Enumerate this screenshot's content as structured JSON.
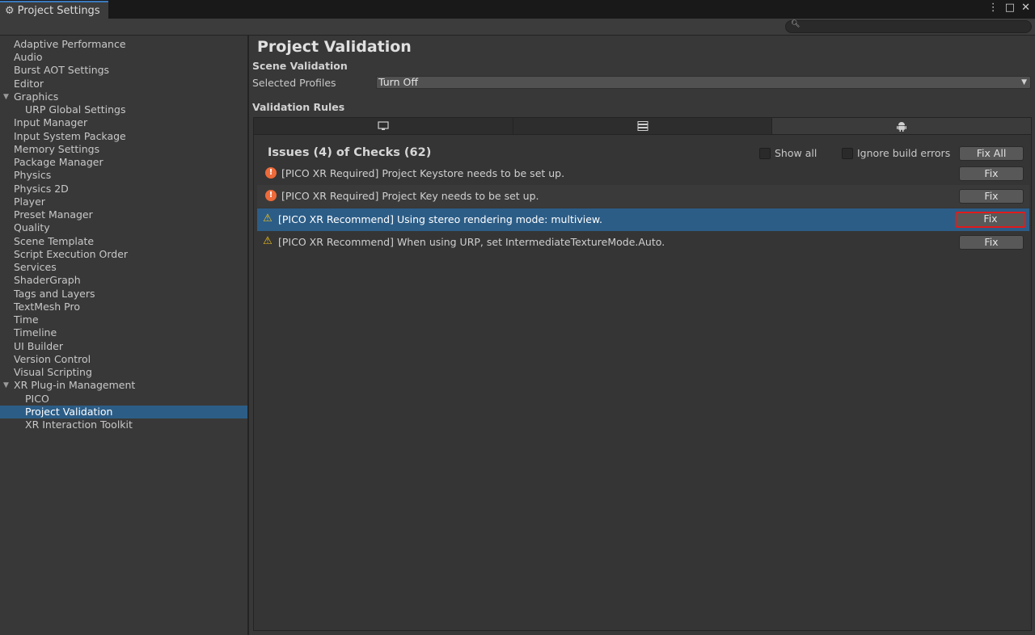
{
  "window": {
    "tab_title": "Project Settings",
    "controls": {
      "menu": "⋮",
      "maximize": "□",
      "close": "✕"
    }
  },
  "search": {
    "placeholder": "",
    "value": ""
  },
  "sidebar": {
    "items": [
      {
        "label": "Adaptive Performance"
      },
      {
        "label": "Audio"
      },
      {
        "label": "Burst AOT Settings"
      },
      {
        "label": "Editor"
      },
      {
        "label": "Graphics"
      },
      {
        "label": "URP Global Settings"
      },
      {
        "label": "Input Manager"
      },
      {
        "label": "Input System Package"
      },
      {
        "label": "Memory Settings"
      },
      {
        "label": "Package Manager"
      },
      {
        "label": "Physics"
      },
      {
        "label": "Physics 2D"
      },
      {
        "label": "Player"
      },
      {
        "label": "Preset Manager"
      },
      {
        "label": "Quality"
      },
      {
        "label": "Scene Template"
      },
      {
        "label": "Script Execution Order"
      },
      {
        "label": "Services"
      },
      {
        "label": "ShaderGraph"
      },
      {
        "label": "Tags and Layers"
      },
      {
        "label": "TextMesh Pro"
      },
      {
        "label": "Time"
      },
      {
        "label": "Timeline"
      },
      {
        "label": "UI Builder"
      },
      {
        "label": "Version Control"
      },
      {
        "label": "Visual Scripting"
      },
      {
        "label": "XR Plug-in Management"
      },
      {
        "label": "PICO"
      },
      {
        "label": "Project Validation"
      },
      {
        "label": "XR Interaction Toolkit"
      }
    ],
    "selected": "Project Validation"
  },
  "main": {
    "title": "Project Validation",
    "scene_validation_label": "Scene Validation",
    "selected_profiles_label": "Selected Profiles",
    "selected_profiles_value": "Turn Off",
    "validation_rules_label": "Validation Rules",
    "platform_tabs": [
      {
        "icon": "monitor-icon"
      },
      {
        "icon": "server-icon"
      },
      {
        "icon": "android-icon"
      }
    ],
    "issues_summary": "Issues (4) of Checks (62)",
    "show_all_label": "Show all",
    "ignore_build_errors_label": "Ignore build errors",
    "fix_all_label": "Fix All",
    "rules": [
      {
        "severity": "error",
        "message": "[PICO XR Required] Project Keystore needs to be set up.",
        "fix_label": "Fix"
      },
      {
        "severity": "error",
        "message": "[PICO XR Required] Project Key needs to be set up.",
        "fix_label": "Fix"
      },
      {
        "severity": "warning",
        "message": "[PICO XR Recommend] Using stereo rendering mode: multiview.",
        "fix_label": "Fix"
      },
      {
        "severity": "warning",
        "message": "[PICO XR Recommend] When using URP, set IntermediateTextureMode.Auto.",
        "fix_label": "Fix"
      }
    ]
  },
  "colors": {
    "accent_selected": "#2c5d87",
    "error": "#ed6a3a",
    "warning": "#f2c21f",
    "highlight_outline": "#e01b1b"
  }
}
